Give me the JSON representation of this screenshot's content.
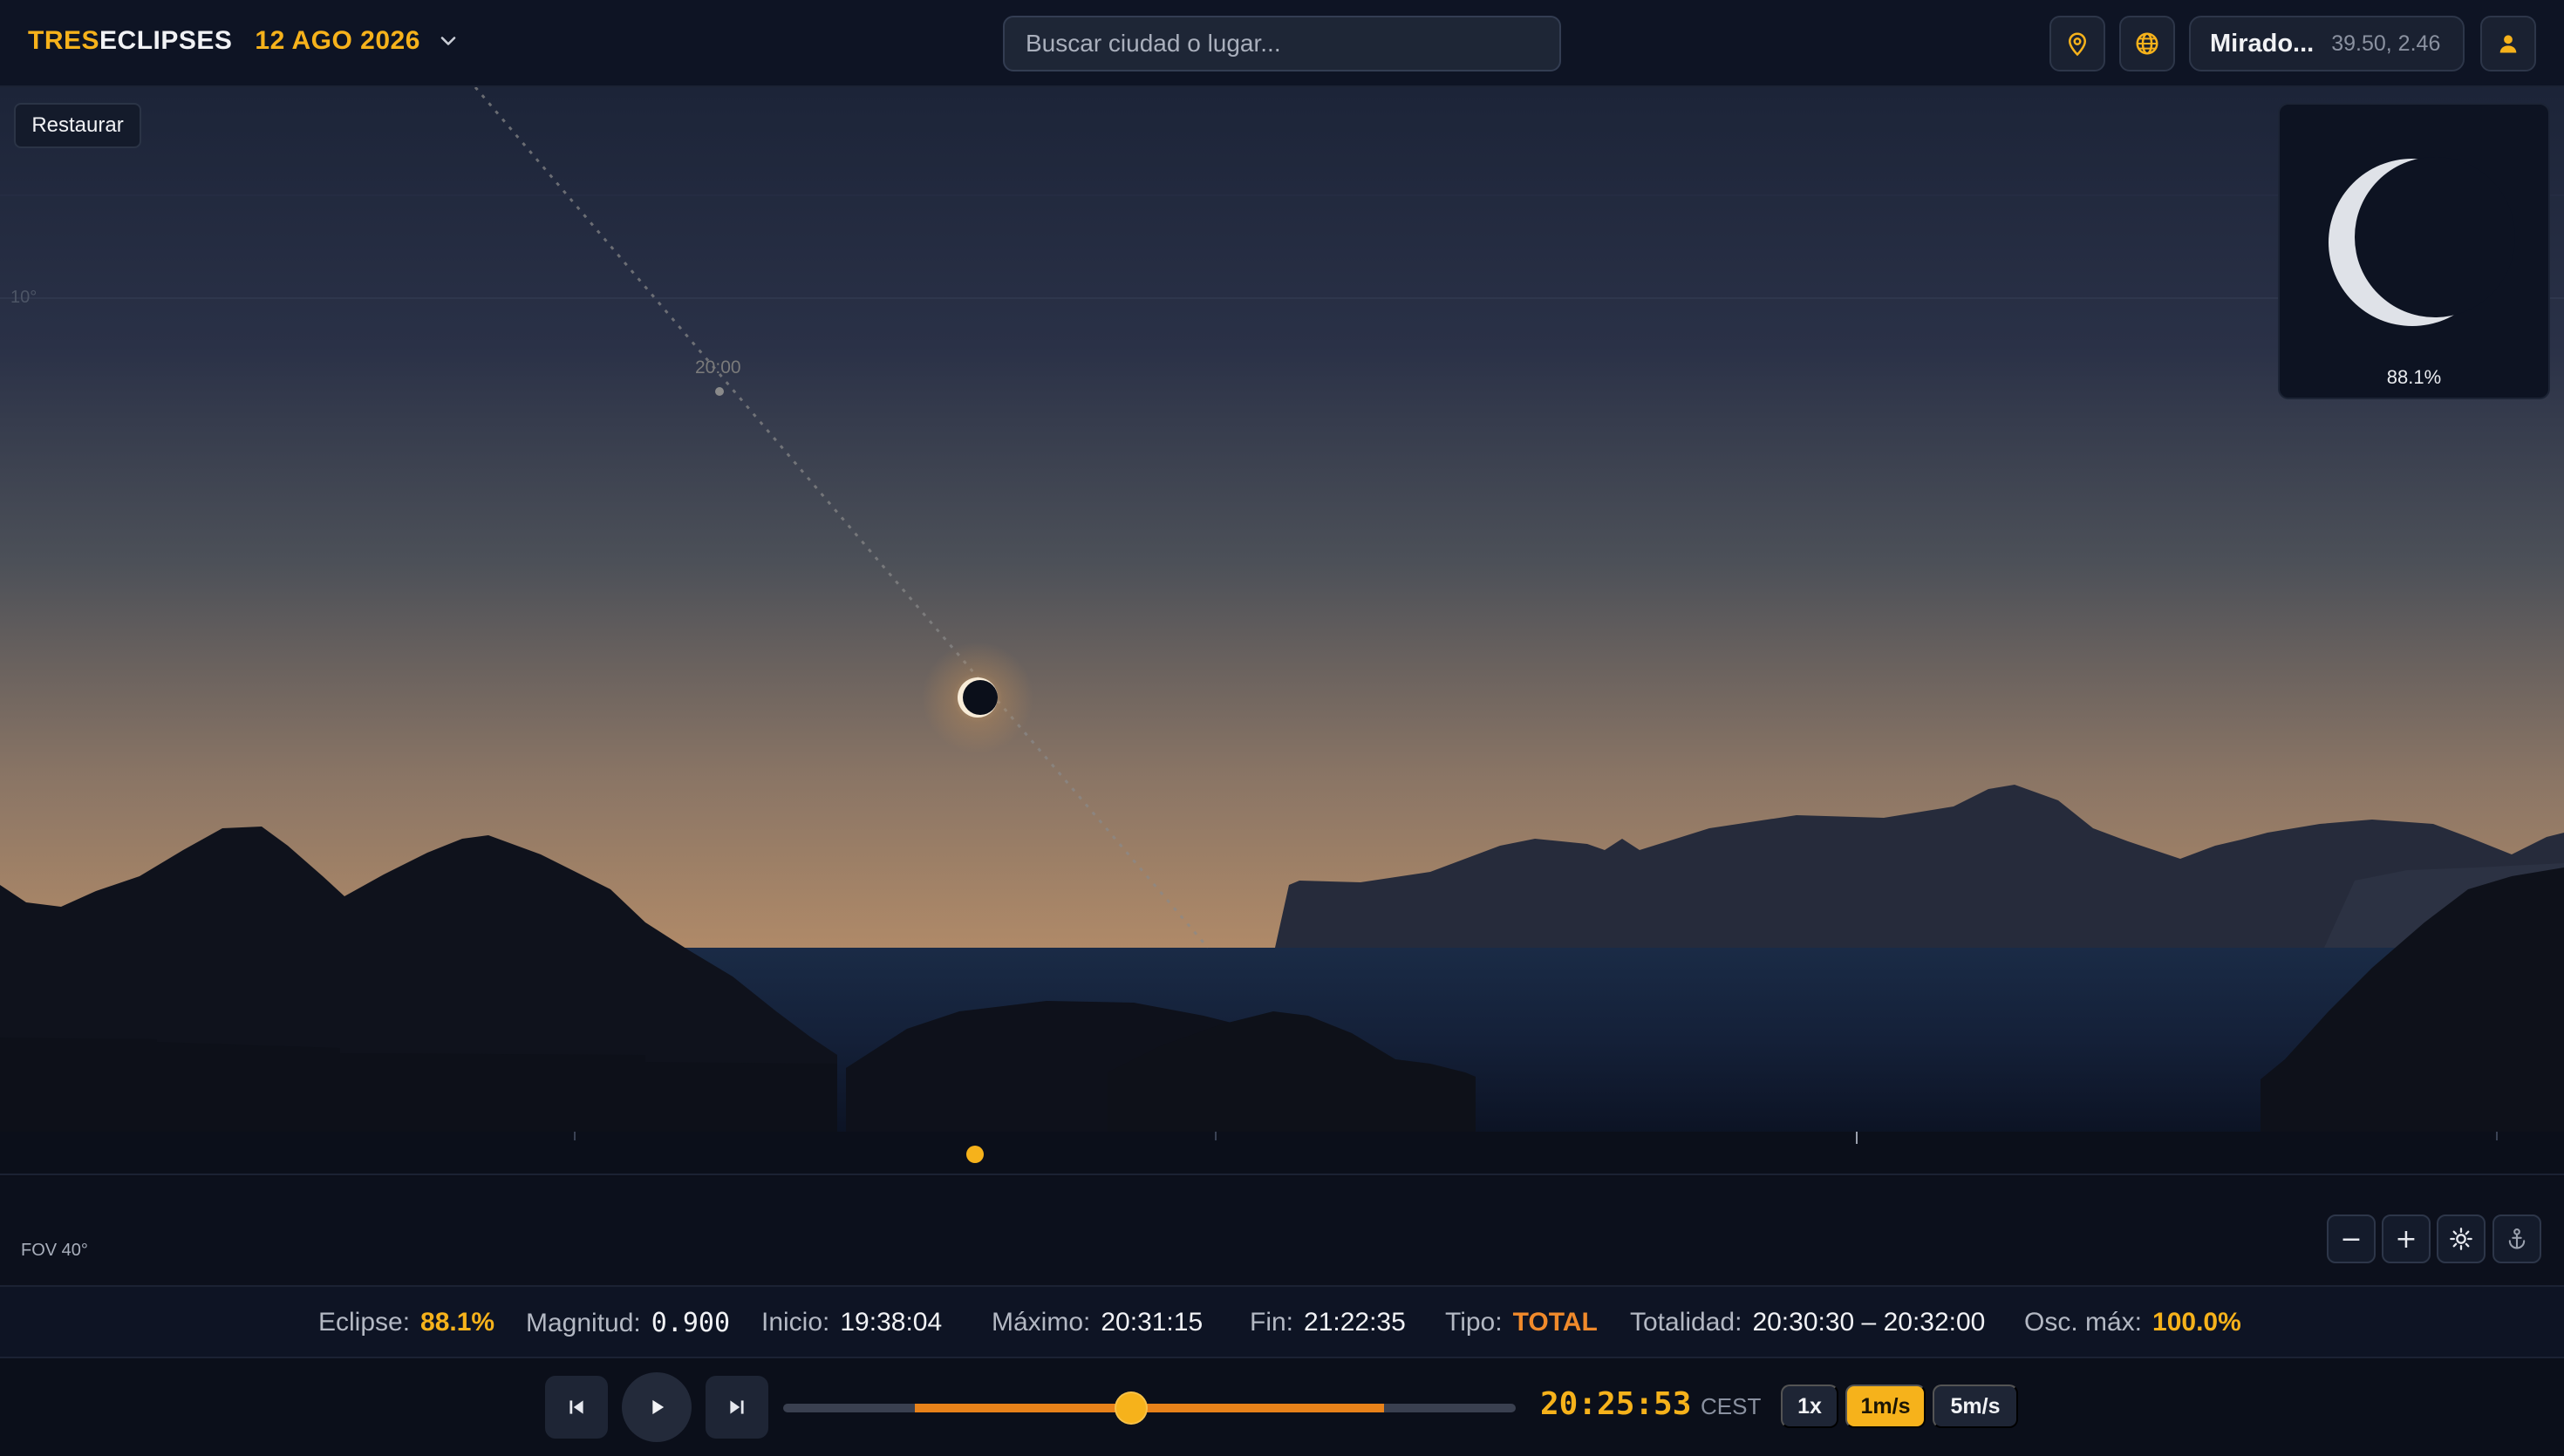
{
  "app": {
    "brand_part1": "TRES",
    "brand_part2": "ECLIPSES",
    "date": "12 AGO 2026"
  },
  "search": {
    "placeholder": "Buscar ciudad o lugar..."
  },
  "location": {
    "name": "Mirado...",
    "coords": "39.50, 2.46"
  },
  "scene": {
    "restore_label": "Restaurar",
    "altitude_label": "10°",
    "time_marker": "20:00",
    "fov_label": "FOV 40°",
    "preview_percent": "88.1%"
  },
  "controls": {
    "zoom_out": "−",
    "zoom_in": "+"
  },
  "info": {
    "eclipse_label": "Eclipse:",
    "eclipse_value": "88.1%",
    "magnitude_label": "Magnitud:",
    "magnitude_value": "0.900",
    "start_label": "Inicio:",
    "start_value": "19:38:04",
    "max_label": "Máximo:",
    "max_value": "20:31:15",
    "end_label": "Fin:",
    "end_value": "21:22:35",
    "type_label": "Tipo:",
    "type_value": "TOTAL",
    "totality_label": "Totalidad:",
    "totality_value": "20:30:30 – 20:32:00",
    "obsc_label": "Osc. máx:",
    "obsc_value": "100.0%"
  },
  "playback": {
    "time": "20:25:53",
    "timezone": "CEST",
    "progress_fraction": 0.475,
    "range_start_fraction": 0.18,
    "range_end_fraction": 0.82,
    "speeds": [
      "1x",
      "1m/s",
      "5m/s"
    ],
    "active_speed": "1m/s"
  },
  "colors": {
    "accent": "#f6b21b",
    "orange": "#f08a2b",
    "background": "#0b0f1a"
  },
  "icons": [
    "chevron-down-icon",
    "map-pin-icon",
    "globe-icon",
    "user-icon",
    "sun-icon",
    "anchor-icon",
    "skip-back-icon",
    "play-icon",
    "skip-forward-icon"
  ]
}
